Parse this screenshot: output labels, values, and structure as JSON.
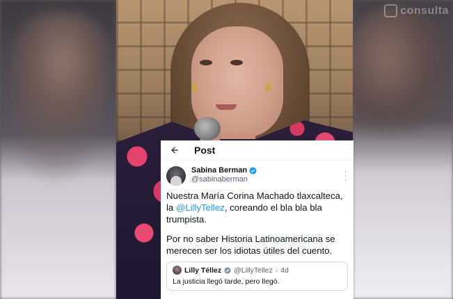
{
  "watermark": {
    "text": "consulta"
  },
  "post": {
    "header_title": "Post",
    "author": {
      "name": "Sabina Berman",
      "handle": "@sabinaberman"
    },
    "text_line1_a": "Nuestra María Corina Machado tlaxcalteca, la ",
    "mention": "@LillyTellez",
    "text_line1_b": ", coreando el bla bla bla trumpista.",
    "text_para2": "Por no saber Historia Latinoamericana se merecen ser los idiotas útiles del cuento.",
    "quote": {
      "name": "Lilly Téllez",
      "handle": "@LillyTellez",
      "separator": "·",
      "time": "4d",
      "text": "La justicia llegó tarde, pero llegó."
    }
  },
  "colors": {
    "verified_blue": "#1d9bf0",
    "text_primary": "#0f1419",
    "text_secondary": "#536471",
    "dress_pink": "#e5436d"
  },
  "icons": {
    "back": "arrow-left-icon",
    "verified": "verified-badge-icon",
    "more": "more-vertical-icon",
    "watermark": "instagram-icon"
  }
}
